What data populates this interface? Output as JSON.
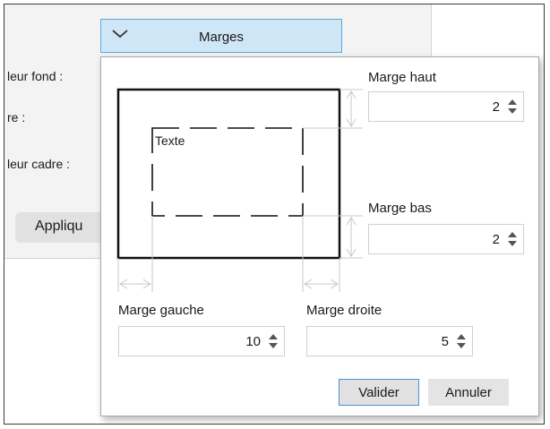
{
  "background": {
    "labels": [
      "leur fond :",
      "re :",
      "leur cadre :"
    ],
    "apply_label": "Appliqu"
  },
  "popup": {
    "header_label": "Marges",
    "preview_text": "Texte",
    "top": {
      "label": "Marge haut",
      "value": "2"
    },
    "bottom": {
      "label": "Marge bas",
      "value": "2"
    },
    "left": {
      "label": "Marge gauche",
      "value": "10"
    },
    "right": {
      "label": "Marge droite",
      "value": "5"
    },
    "validate_label": "Valider",
    "cancel_label": "Annuler"
  },
  "colors": {
    "header_bg": "#cfe6f7",
    "header_border": "#5fa8dc",
    "primary_border": "#4a90d9"
  }
}
